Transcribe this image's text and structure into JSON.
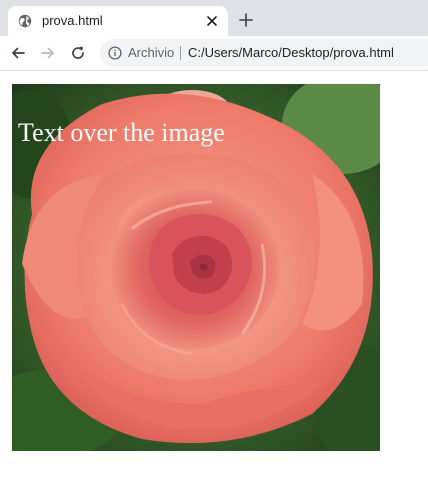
{
  "tab": {
    "title": "prova.html"
  },
  "address_bar": {
    "origin_label": "Archivio",
    "url": "C:/Users/Marco/Desktop/prova.html"
  },
  "page": {
    "overlay_text": "Text over the image"
  },
  "icons": {
    "favicon": "globe-icon",
    "close": "close-icon",
    "new_tab": "plus-icon",
    "back": "back-arrow-icon",
    "forward": "forward-arrow-icon",
    "reload": "reload-icon",
    "info": "info-icon"
  },
  "colors": {
    "tabstrip": "#dee1e6",
    "omnibox": "#f1f3f4",
    "rose": "#ee7a6a",
    "foliage": "#3d6b2e",
    "overlay_text": "#ffffff"
  }
}
